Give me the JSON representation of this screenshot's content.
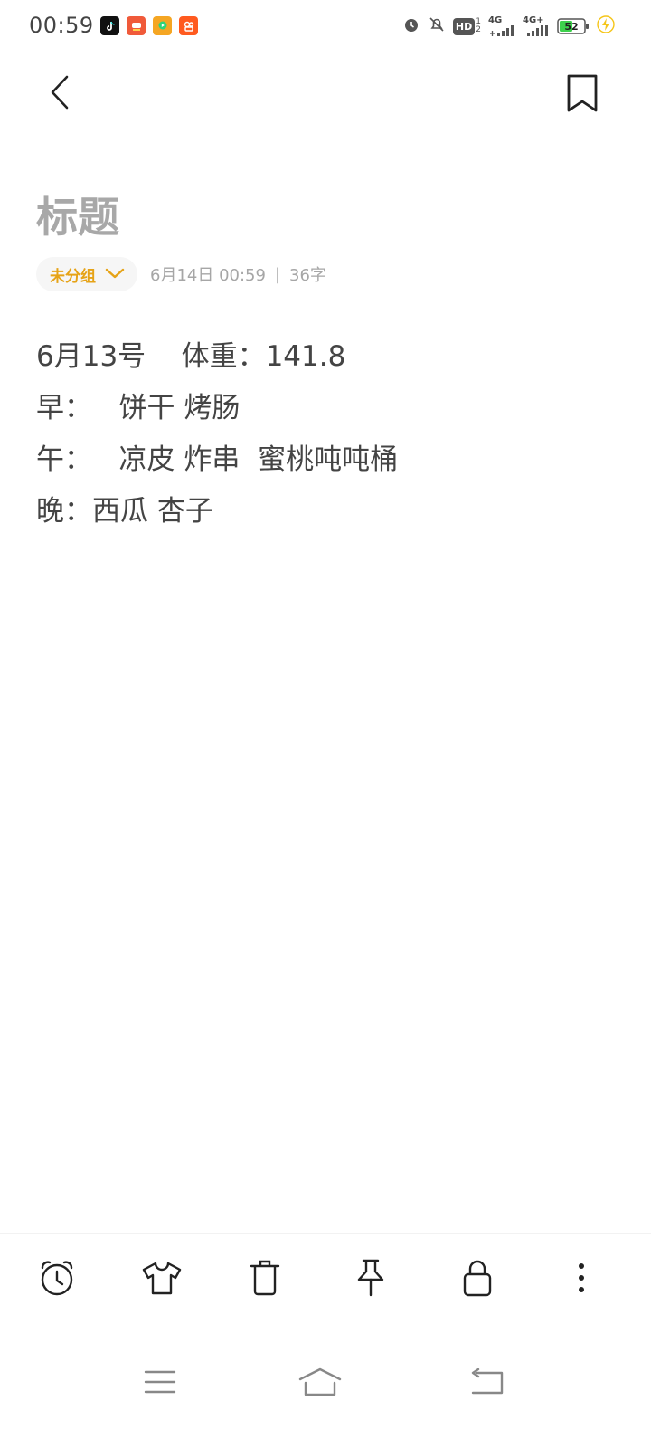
{
  "status_bar": {
    "time": "00:59",
    "apps": [
      "tiktok-icon",
      "app-red-icon",
      "video-app-icon",
      "kuaishou-icon"
    ],
    "signal_1": "4G",
    "signal_2": "4G+",
    "hd_label": "HD",
    "battery_level": "52"
  },
  "header": {
    "back_icon": "chevron-left-icon",
    "bookmark_icon": "bookmark-icon"
  },
  "note": {
    "title": "标题",
    "group": "未分组",
    "date": "6月14日 00:59",
    "separator": "|",
    "word_count": "36字",
    "lines": [
      "6月13号    体重：141.8",
      "早：   饼干 烤肠",
      "午：   凉皮 炸串  蜜桃吨吨桶",
      "晚：西瓜 杏子"
    ]
  },
  "toolbar": {
    "items": [
      "alarm-clock-icon",
      "tshirt-icon",
      "trash-icon",
      "pin-icon",
      "lock-icon",
      "more-vertical-icon"
    ]
  },
  "navbar": {
    "items": [
      "menu-icon",
      "home-icon",
      "back-icon"
    ]
  },
  "colors": {
    "accent": "#e6a317",
    "title": "#a8a8a8",
    "text": "#444444",
    "meta": "#a6a6a6"
  }
}
